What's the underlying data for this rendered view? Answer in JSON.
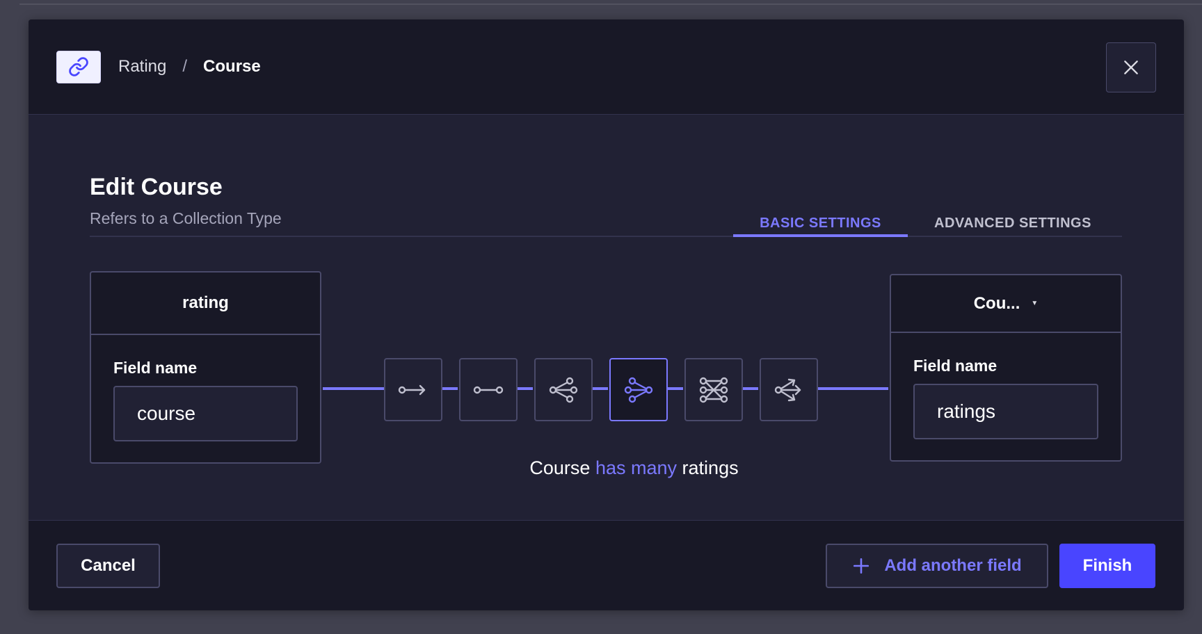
{
  "breadcrumb": {
    "parent": "Rating",
    "separator": "/",
    "current": "Course"
  },
  "header": {
    "icon": "link-icon",
    "close_icon": "close-icon"
  },
  "main": {
    "title": "Edit Course",
    "subtitle": "Refers to a Collection Type",
    "tabs": [
      {
        "label": "BASIC SETTINGS",
        "active": true
      },
      {
        "label": "ADVANCED SETTINGS",
        "active": false
      }
    ]
  },
  "left_box": {
    "title": "rating",
    "field_label": "Field name",
    "field_value": "course"
  },
  "right_box": {
    "title": "Cou...",
    "dropdown_icon": "chevron-down-icon",
    "field_label": "Field name",
    "field_value": "ratings"
  },
  "relations": [
    {
      "icon": "one-way-icon",
      "active": false
    },
    {
      "icon": "one-to-one-icon",
      "active": false
    },
    {
      "icon": "one-to-many-icon",
      "active": false
    },
    {
      "icon": "many-to-one-icon",
      "active": true
    },
    {
      "icon": "many-to-many-icon",
      "active": false
    },
    {
      "icon": "many-way-icon",
      "active": false
    }
  ],
  "relation_description": {
    "start": "Course",
    "highlight": "has many",
    "end": "ratings"
  },
  "footer": {
    "cancel_label": "Cancel",
    "add_label": "Add another field",
    "add_icon": "plus-icon",
    "finish_label": "Finish"
  },
  "colors": {
    "accent": "#7b79ff",
    "primary": "#4945ff",
    "background": "#212134",
    "surface": "#181826",
    "border": "#4a4a6a"
  }
}
